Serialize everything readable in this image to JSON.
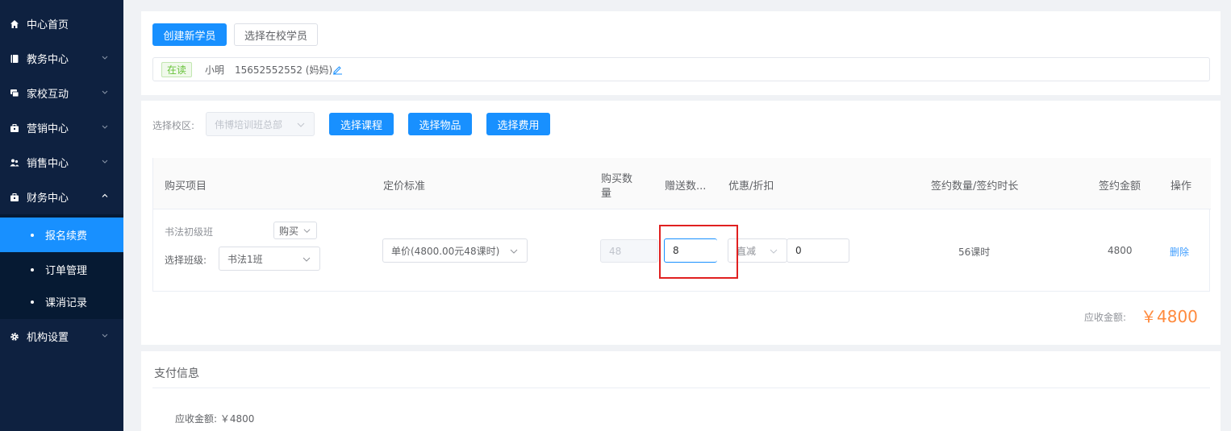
{
  "sidebar": {
    "items": [
      {
        "label": "中心首页",
        "icon": "home-icon"
      },
      {
        "label": "教务中心",
        "icon": "book-icon"
      },
      {
        "label": "家校互动",
        "icon": "chat-icon"
      },
      {
        "label": "营销中心",
        "icon": "briefcase-icon"
      },
      {
        "label": "销售中心",
        "icon": "users-icon"
      },
      {
        "label": "财务中心",
        "icon": "wallet-icon"
      },
      {
        "label": "机构设置",
        "icon": "gear-icon"
      }
    ],
    "finance_sub": [
      {
        "label": "报名续费",
        "active": true
      },
      {
        "label": "订单管理",
        "active": false
      },
      {
        "label": "课消记录",
        "active": false
      }
    ]
  },
  "student_card": {
    "create_btn": "创建新学员",
    "select_btn": "选择在校学员",
    "tag": "在读",
    "name": "小明",
    "phone": "15652552552 (妈妈)"
  },
  "order_card": {
    "campus_label": "选择校区:",
    "campus_value": "伟博培训班总部",
    "btn_course": "选择课程",
    "btn_goods": "选择物品",
    "btn_fee": "选择费用",
    "table": {
      "headers": {
        "item": "购买项目",
        "pricing": "定价标准",
        "qty_line1": "购买数",
        "qty_line2": "量",
        "gift": "赠送数...",
        "discount": "优惠/折扣",
        "contract": "签约数量/签约时长",
        "amount": "签约金额",
        "action": "操作"
      },
      "row": {
        "course": "书法初级班",
        "buy_type": "购买",
        "class_label": "选择班级:",
        "class_value": "书法1班",
        "pricing": "单价(4800.00元48课时)",
        "qty": "48",
        "gift": "8",
        "discount_type": "直减",
        "discount_value": "0",
        "contract": "56课时",
        "amount": "4800",
        "delete": "删除"
      }
    },
    "receivable_label": "应收金额:",
    "receivable_value": "￥4800"
  },
  "payment_card": {
    "title": "支付信息",
    "receivable_line": "应收金额: ￥4800"
  },
  "colors": {
    "sidebar_bg": "#0e2140",
    "primary": "#1890ff",
    "amount_orange": "#ff8a3d",
    "highlight_red": "#e02020"
  }
}
